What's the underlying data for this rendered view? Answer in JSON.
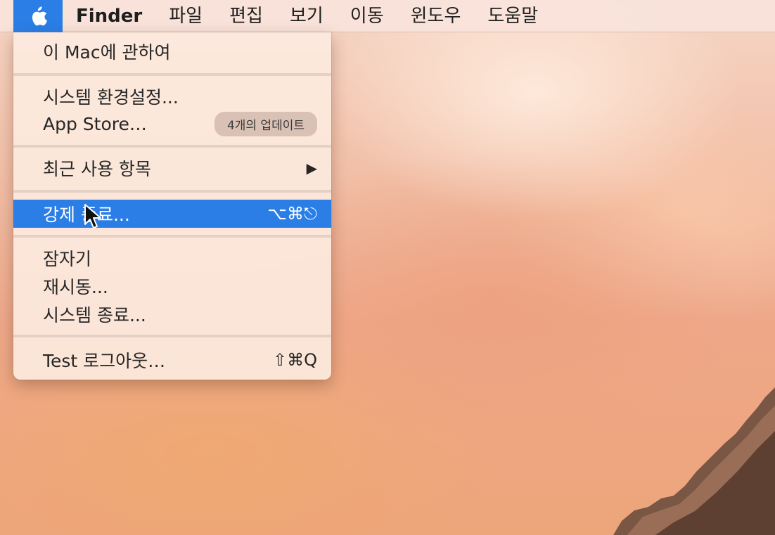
{
  "menubar": {
    "apple_icon": "apple-logo",
    "app_name": "Finder",
    "items": [
      "파일",
      "편집",
      "보기",
      "이동",
      "윈도우",
      "도움말"
    ]
  },
  "apple_menu": {
    "about": "이 Mac에 관하여",
    "system_preferences": "시스템 환경설정...",
    "app_store": "App Store…",
    "app_store_badge": "4개의 업데이트",
    "recent_items": "최근 사용 항목",
    "force_quit": "강제 종료...",
    "force_quit_shortcut": "⌥⌘⎋",
    "sleep": "잠자기",
    "restart": "재시동...",
    "shutdown": "시스템 종료...",
    "logout": "Test 로그아웃…",
    "logout_shortcut": "⇧⌘Q"
  },
  "colors": {
    "highlight": "#2b7ee6",
    "menu_background": "#fceade"
  }
}
